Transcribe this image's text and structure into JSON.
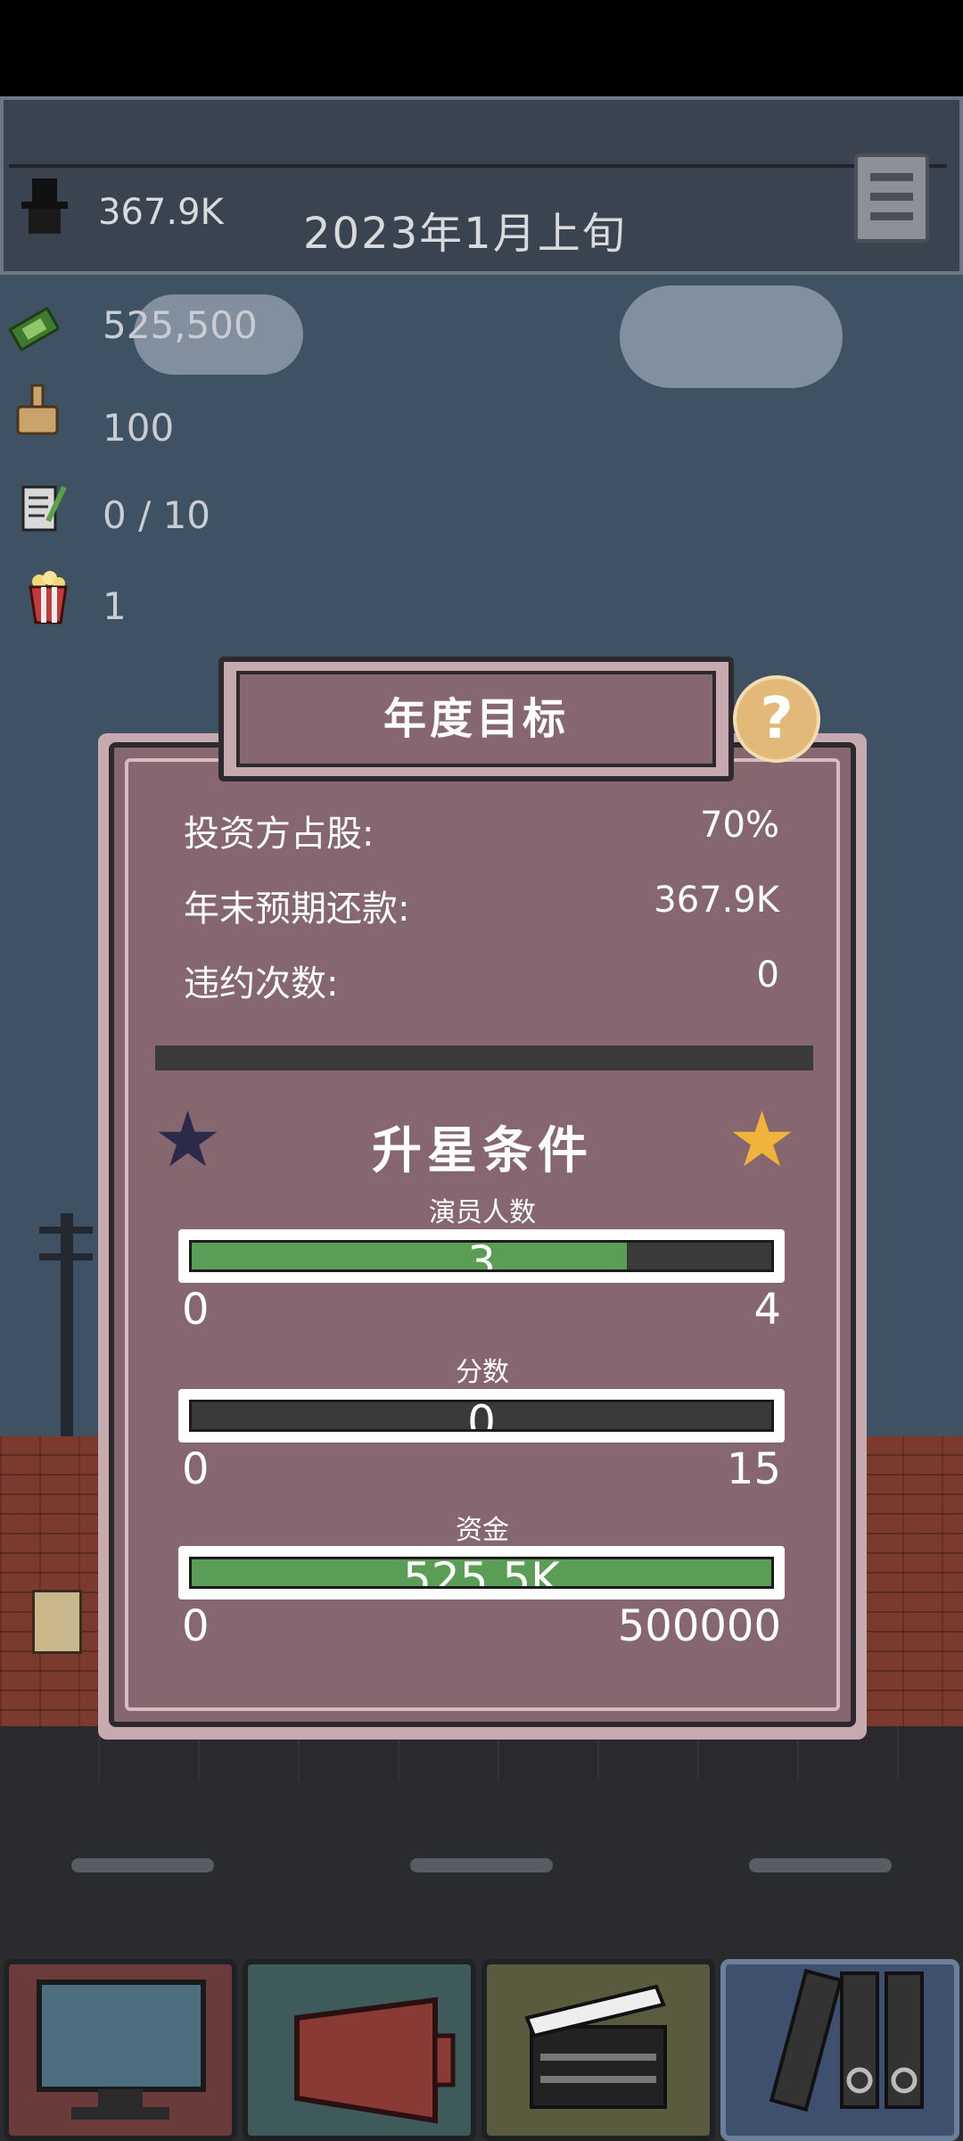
{
  "header": {
    "budget": "367.9K",
    "date": "2023年1月上旬"
  },
  "stats": [
    {
      "icon": "money-icon",
      "value": "525,500"
    },
    {
      "icon": "thumbs-up-icon",
      "value": "100"
    },
    {
      "icon": "script-icon",
      "value": "0 / 10"
    },
    {
      "icon": "popcorn-icon",
      "value": "1"
    }
  ],
  "modal": {
    "title": "年度目标",
    "help": "?",
    "rows": [
      {
        "label": "投资方占股:",
        "value": "70%"
      },
      {
        "label": "年末预期还款:",
        "value": "367.9K"
      },
      {
        "label": "违约次数:",
        "value": "0"
      }
    ],
    "upgrade_title": "升星条件",
    "bars": [
      {
        "label": "演员人数",
        "value": "3",
        "min": "0",
        "max": "4",
        "fill": 0.75
      },
      {
        "label": "分数",
        "value": "0",
        "min": "0",
        "max": "15",
        "fill": 0
      },
      {
        "label": "资金",
        "value": "525.5K",
        "min": "0",
        "max": "500000",
        "fill": 1
      }
    ]
  },
  "nav": [
    {
      "icon": "computer-icon",
      "color": "#6b3a3a"
    },
    {
      "icon": "megaphone-icon",
      "color": "#3f5a5a"
    },
    {
      "icon": "clapperboard-icon",
      "color": "#5a5a3e"
    },
    {
      "icon": "folders-icon",
      "color": "#3f4f6e"
    }
  ],
  "colors": {
    "sky": "#3f5264",
    "modal": "#866770",
    "bar_fill": "#5a9e55",
    "star_dark": "#2c2a4a",
    "star_gold": "#f0b43a"
  }
}
